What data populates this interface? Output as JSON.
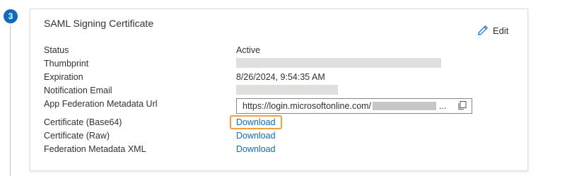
{
  "step": {
    "number": "3"
  },
  "card": {
    "title": "SAML Signing Certificate",
    "edit_label": "Edit"
  },
  "fields": {
    "status_label": "Status",
    "status_value": "Active",
    "thumbprint_label": "Thumbprint",
    "expiration_label": "Expiration",
    "expiration_value": "8/26/2024, 9:54:35 AM",
    "notification_label": "Notification Email",
    "metadata_url_label": "App Federation Metadata Url",
    "metadata_url_value": "https://login.microsoftonline.com/",
    "metadata_url_ellipsis": "...",
    "cert_base64_label": "Certificate (Base64)",
    "cert_base64_link": "Download",
    "cert_raw_label": "Certificate (Raw)",
    "cert_raw_link": "Download",
    "fed_xml_label": "Federation Metadata XML",
    "fed_xml_link": "Download"
  },
  "colors": {
    "accent": "#0f6cbd",
    "highlight": "#f0a040",
    "redaction": "#e1dfdd"
  }
}
